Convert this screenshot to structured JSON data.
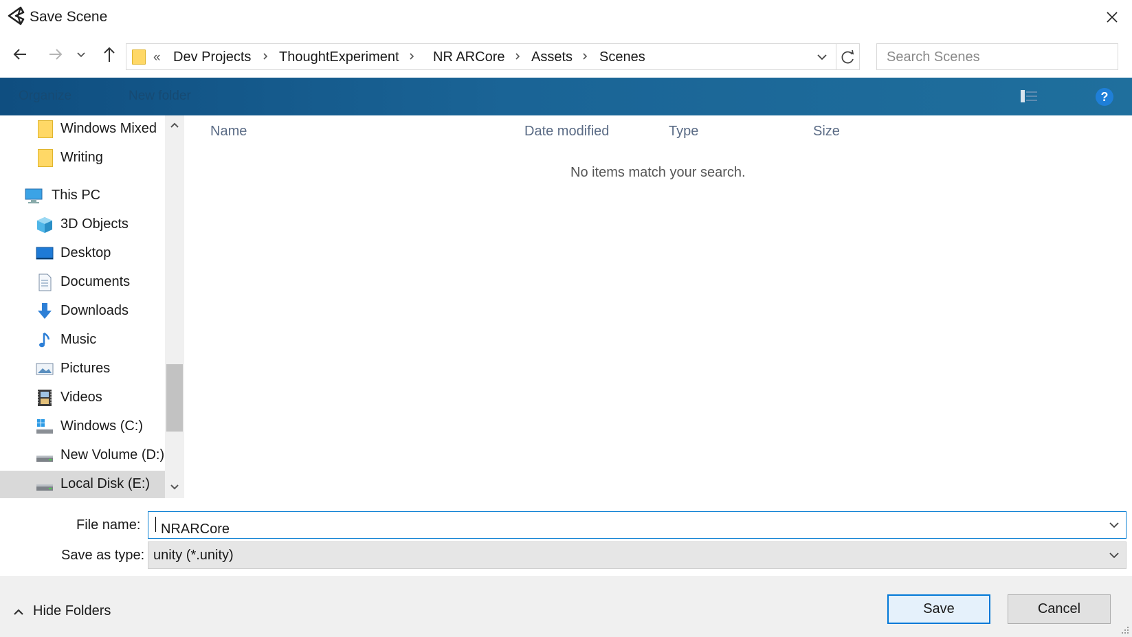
{
  "window": {
    "title": "Save Scene"
  },
  "address": {
    "overflow": "«",
    "crumbs": [
      "Dev Projects",
      "ThoughtExperiment",
      "NR ARCore",
      "Assets",
      "Scenes"
    ]
  },
  "search": {
    "placeholder": "Search Scenes"
  },
  "toolbar": {
    "organize": "Organize",
    "new_folder": "New folder"
  },
  "nav": {
    "items": [
      {
        "label": "Windows Mixed",
        "icon": "folder-icon"
      },
      {
        "label": "Writing",
        "icon": "folder-icon"
      },
      {
        "label": "This PC",
        "icon": "computer-icon"
      },
      {
        "label": "3D Objects",
        "icon": "cube-icon"
      },
      {
        "label": "Desktop",
        "icon": "desktop-icon"
      },
      {
        "label": "Documents",
        "icon": "documents-icon"
      },
      {
        "label": "Downloads",
        "icon": "download-icon"
      },
      {
        "label": "Music",
        "icon": "music-icon"
      },
      {
        "label": "Pictures",
        "icon": "pictures-icon"
      },
      {
        "label": "Videos",
        "icon": "videos-icon"
      },
      {
        "label": "Windows (C:)",
        "icon": "windows-drive-icon"
      },
      {
        "label": "New Volume (D:)",
        "icon": "drive-icon"
      },
      {
        "label": "Local Disk (E:)",
        "icon": "drive-icon",
        "selected": true
      }
    ]
  },
  "columns": {
    "name": "Name",
    "date_modified": "Date modified",
    "type": "Type",
    "size": "Size"
  },
  "content": {
    "empty_message": "No items match your search."
  },
  "form": {
    "file_name_label": "File name:",
    "file_name_value": "NRARCore",
    "save_type_label": "Save as type:",
    "save_type_value": "unity (*.unity)"
  },
  "footer": {
    "hide_folders": "Hide Folders",
    "save": "Save",
    "cancel": "Cancel"
  },
  "colors": {
    "toolbar": "#1a6496",
    "accent": "#0078d7",
    "folder": "#ffd866"
  }
}
